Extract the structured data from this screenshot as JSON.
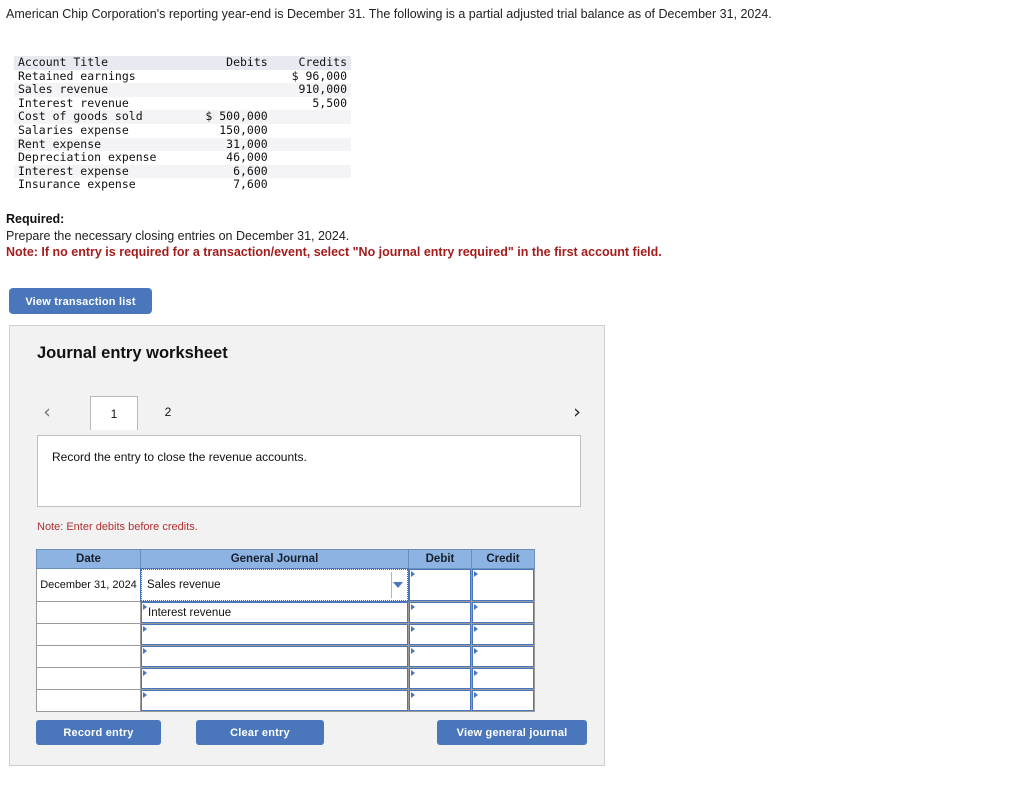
{
  "intro": {
    "text": "American Chip Corporation's reporting year-end is December 31. The following is a partial adjusted trial balance as of December 31, 2024."
  },
  "trial_balance": {
    "columns": [
      "Account Title",
      "Debits",
      "Credits"
    ],
    "rows": [
      {
        "account": "Retained earnings",
        "debit": "",
        "credit": "$ 96,000"
      },
      {
        "account": "Sales revenue",
        "debit": "",
        "credit": "910,000"
      },
      {
        "account": "Interest revenue",
        "debit": "",
        "credit": "5,500"
      },
      {
        "account": "Cost of goods sold",
        "debit": "$ 500,000",
        "credit": ""
      },
      {
        "account": "Salaries expense",
        "debit": "150,000",
        "credit": ""
      },
      {
        "account": "Rent expense",
        "debit": "31,000",
        "credit": ""
      },
      {
        "account": "Depreciation expense",
        "debit": "46,000",
        "credit": ""
      },
      {
        "account": "Interest expense",
        "debit": "6,600",
        "credit": ""
      },
      {
        "account": "Insurance expense",
        "debit": "7,600",
        "credit": ""
      }
    ]
  },
  "required": {
    "title": "Required:",
    "line": "Prepare the necessary closing entries on December 31, 2024.",
    "note": "Note: If no entry is required for a transaction/event, select \"No journal entry required\" in the first account field."
  },
  "buttons": {
    "view_transaction_list": "View transaction list",
    "record_entry": "Record entry",
    "clear_entry": "Clear entry",
    "view_general_journal": "View general journal"
  },
  "worksheet": {
    "title": "Journal entry worksheet",
    "tabs": [
      {
        "label": "1",
        "active": true
      },
      {
        "label": "2",
        "active": false
      }
    ],
    "prev_icon": "‹",
    "next_icon": "›",
    "instruction": "Record the entry to close the revenue accounts.",
    "enter_note": "Note: Enter debits before credits."
  },
  "journal": {
    "columns": [
      "Date",
      "General Journal",
      "Debit",
      "Credit"
    ],
    "rows": [
      {
        "date": "December 31, 2024",
        "account": "Sales revenue",
        "debit": "",
        "credit": ""
      },
      {
        "date": "",
        "account": "Interest revenue",
        "debit": "",
        "credit": ""
      },
      {
        "date": "",
        "account": "",
        "debit": "",
        "credit": ""
      },
      {
        "date": "",
        "account": "",
        "debit": "",
        "credit": ""
      },
      {
        "date": "",
        "account": "",
        "debit": "",
        "credit": ""
      },
      {
        "date": "",
        "account": "",
        "debit": "",
        "credit": ""
      }
    ]
  },
  "colors": {
    "button_blue": "#4a77bb",
    "table_header_blue": "#8db3e2",
    "note_red": "#a51c1c",
    "panel_gray": "#f2f2f2"
  }
}
